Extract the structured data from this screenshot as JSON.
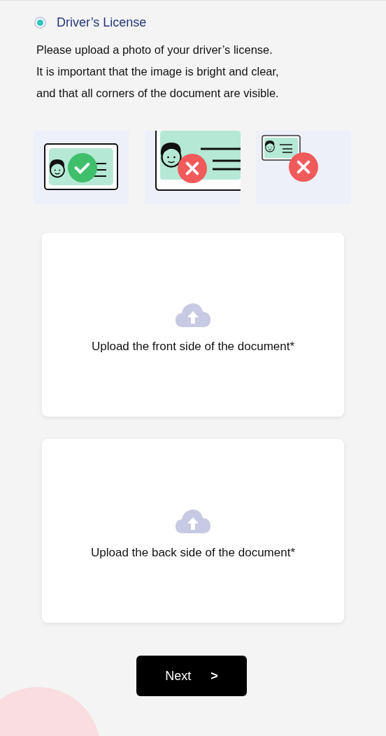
{
  "document_option": {
    "label": "Driver’s License",
    "selected": true
  },
  "instructions": [
    "Please upload a photo of your driver’s license.",
    "It is important that the image is bright and clear,",
    "and that all corners of the document are visible."
  ],
  "examples": [
    {
      "kind": "good"
    },
    {
      "kind": "cropped"
    },
    {
      "kind": "small"
    }
  ],
  "uploads": [
    {
      "label": "Upload the front side of the document*"
    },
    {
      "label": "Upload the back side of the document*"
    }
  ],
  "next_button": {
    "label": "Next",
    "arrow": ">"
  }
}
